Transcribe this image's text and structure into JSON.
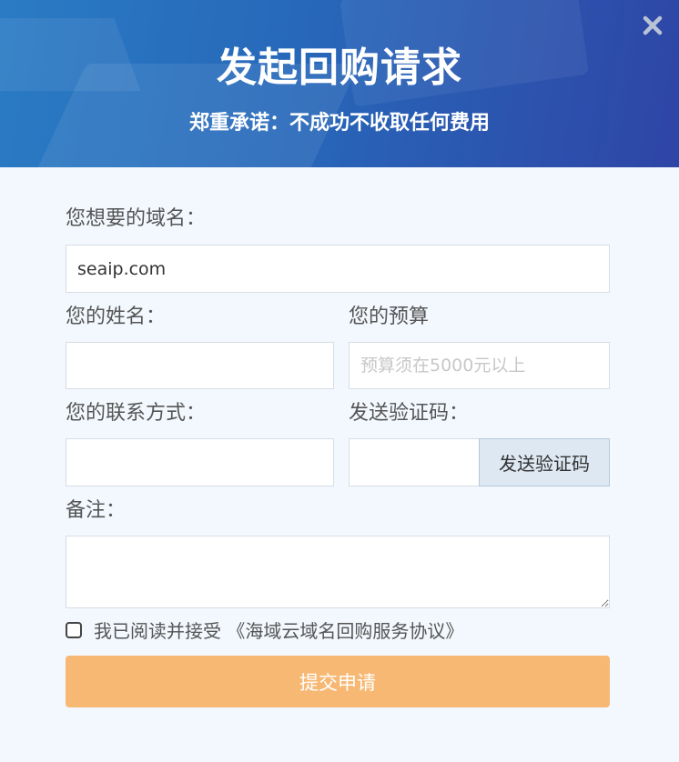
{
  "header": {
    "title": "发起回购请求",
    "subtitle": "郑重承诺：不成功不收取任何费用",
    "close_icon": "close-icon"
  },
  "form": {
    "domain_label": "您想要的域名：",
    "domain_value": "seaip.com",
    "name_label": "您的姓名：",
    "name_value": "",
    "budget_label": "您的预算",
    "budget_placeholder": "预算须在5000元以上",
    "contact_label": "您的联系方式：",
    "contact_value": "",
    "code_label": "发送验证码：",
    "code_value": "",
    "code_button": "发送验证码",
    "remark_label": "备注：",
    "agree_text": "我已阅读并接受",
    "agreement_link": "《海域云域名回购服务协议》",
    "agree_checked": false,
    "submit_label": "提交申请"
  },
  "colors": {
    "header_start": "#2a7bc4",
    "header_end": "#2f45a6",
    "submit_bg": "#f7b873",
    "code_button_bg": "#dde8f3"
  }
}
